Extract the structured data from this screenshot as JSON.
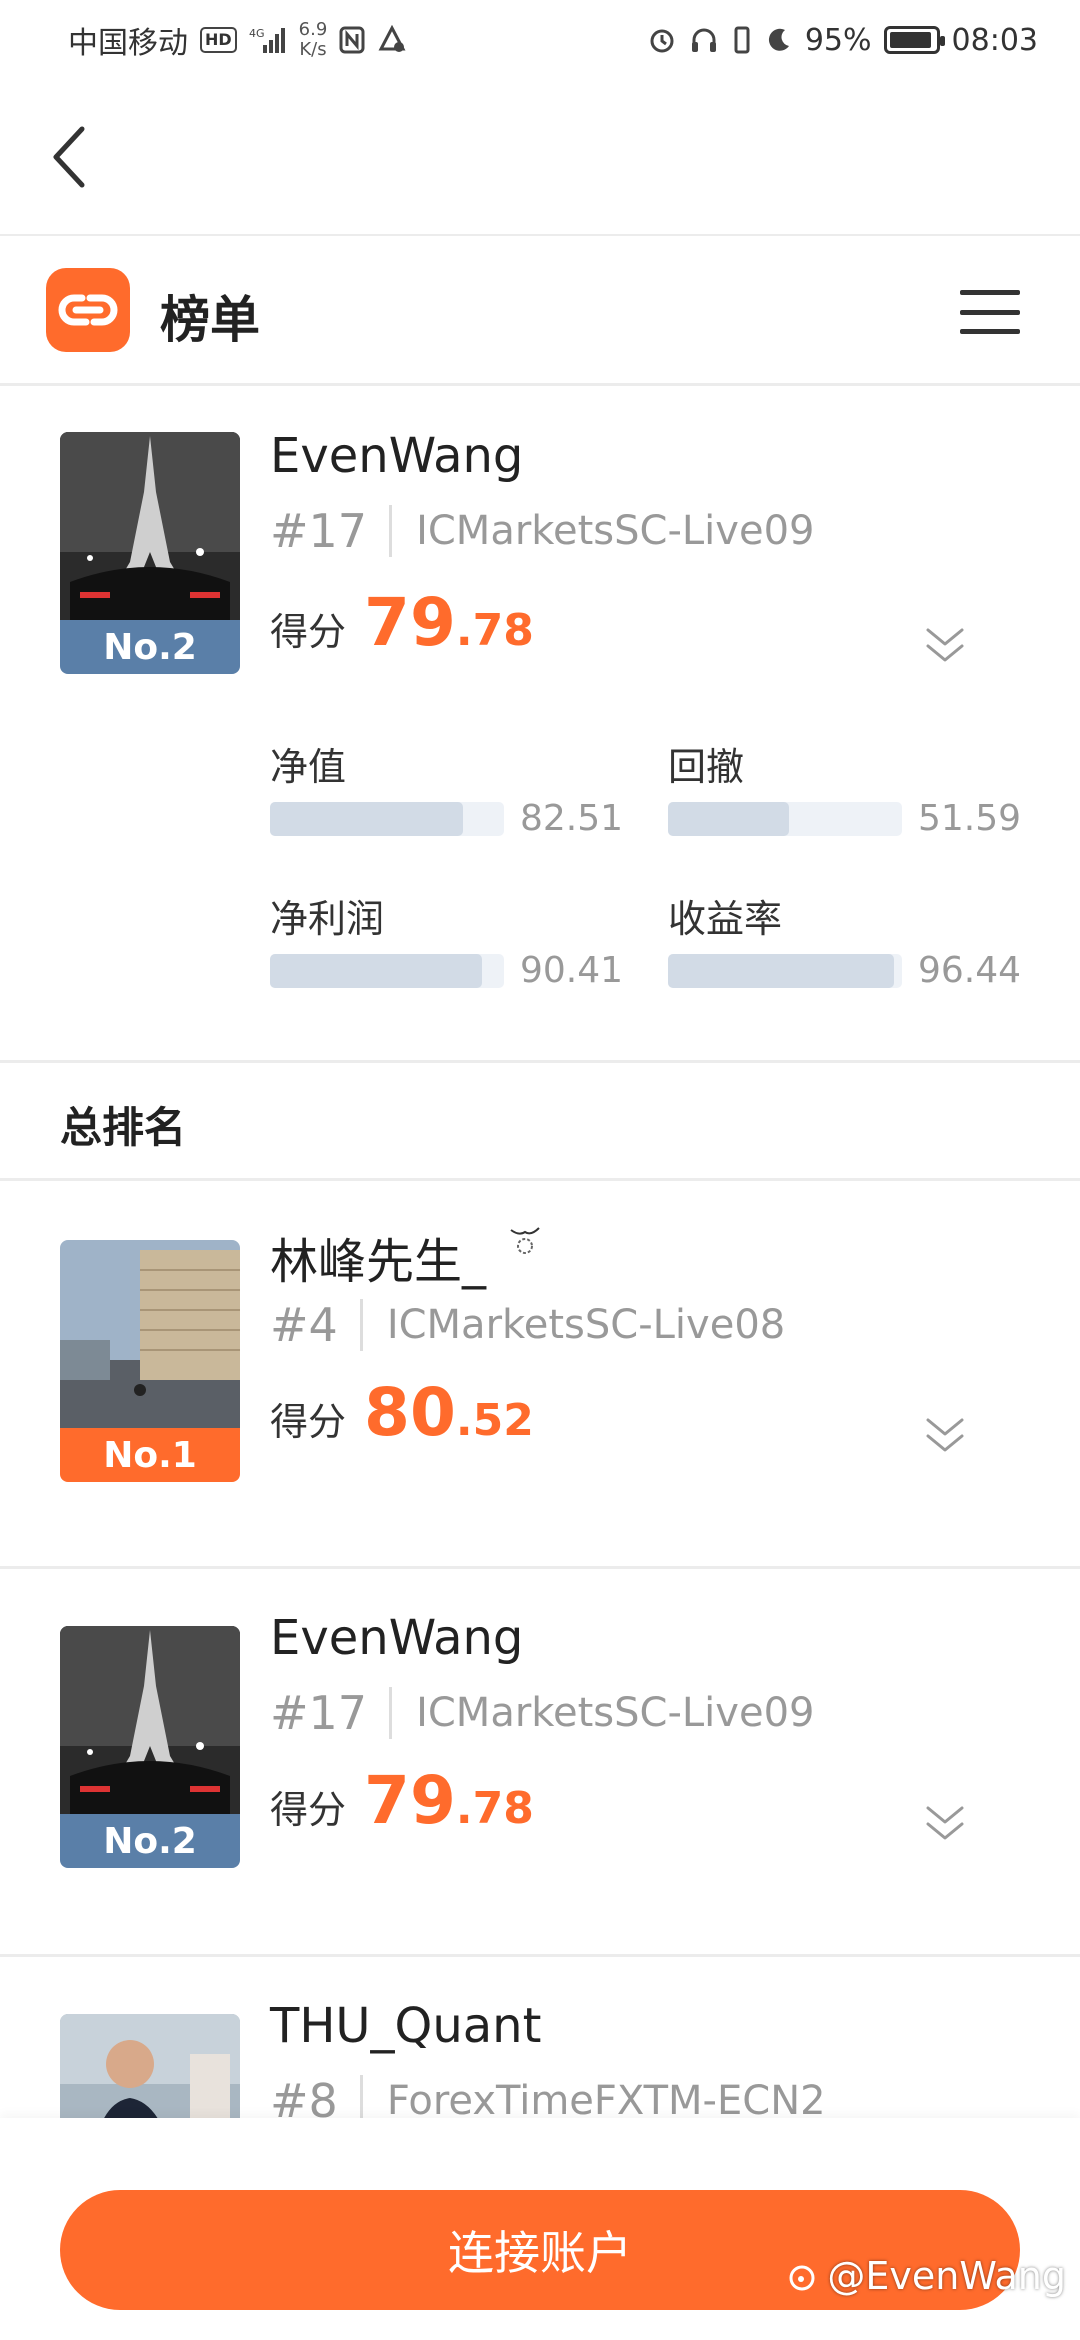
{
  "status_bar": {
    "carrier": "中国移动",
    "hd": "HD",
    "signal_label": "4G",
    "net_speed_value": "6.9",
    "net_speed_unit": "K/s",
    "battery": "95%",
    "battery_level": 0.95,
    "time": "08:03"
  },
  "header": {
    "title": "榜单"
  },
  "featured": {
    "name": "EvenWang",
    "rank": "#17",
    "server": "ICMarketsSC-Live09",
    "badge": "No.2",
    "score_label": "得分",
    "score_int": "79",
    "score_dec": ".78",
    "metrics": [
      {
        "label": "净值",
        "value": "82.51",
        "fraction": 0.8251
      },
      {
        "label": "回撤",
        "value": "51.59",
        "fraction": 0.5159
      },
      {
        "label": "净利润",
        "value": "90.41",
        "fraction": 0.9041
      },
      {
        "label": "收益率",
        "value": "96.44",
        "fraction": 0.9644
      }
    ]
  },
  "section": {
    "title": "总排名"
  },
  "ranking": [
    {
      "name": "林峰先生_",
      "rank": "#4",
      "server": "ICMarketsSC-Live08",
      "badge": "No.1",
      "score_label": "得分",
      "score_int": "80",
      "score_dec": ".52"
    },
    {
      "name": "EvenWang",
      "rank": "#17",
      "server": "ICMarketsSC-Live09",
      "badge": "No.2",
      "score_label": "得分",
      "score_int": "79",
      "score_dec": ".78"
    },
    {
      "name": "THU_Quant",
      "rank": "#8",
      "server": "ForexTimeFXTM-ECN2"
    }
  ],
  "bottom": {
    "connect_label": "连接账户",
    "watermark": "@EvenWang"
  },
  "colors": {
    "accent": "#ff6b2c",
    "badge_blue": "#5a7fa8"
  },
  "icons": [
    "back-icon",
    "logo-icon",
    "menu-icon",
    "chevron-down-icon"
  ]
}
